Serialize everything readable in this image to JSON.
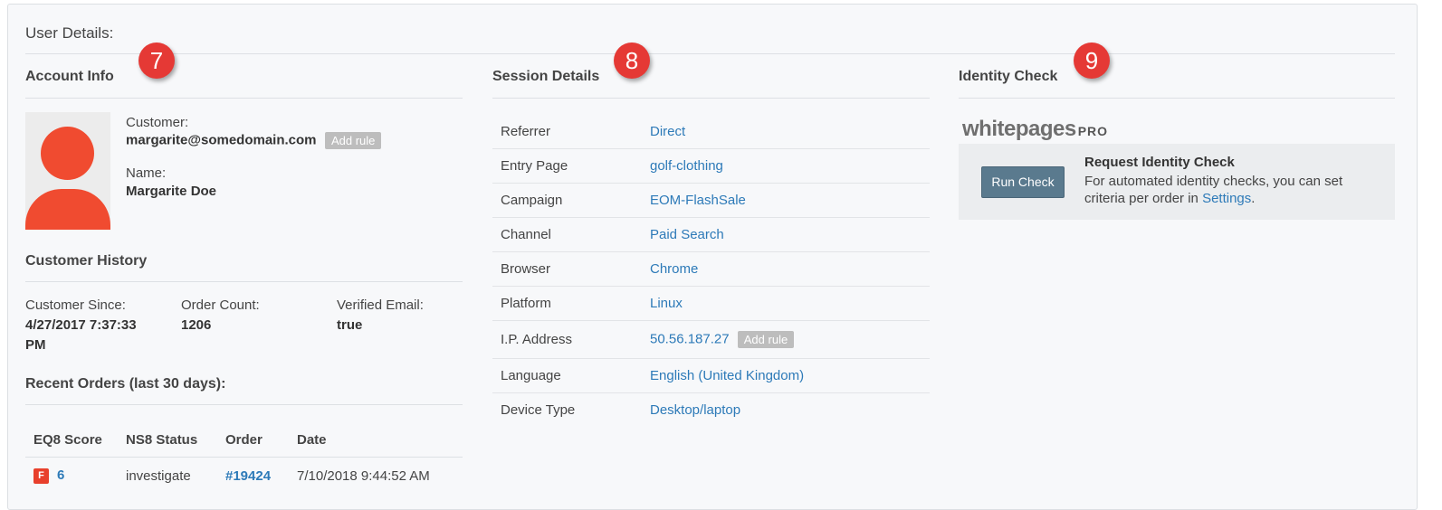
{
  "panel": {
    "title": "User Details:"
  },
  "account": {
    "heading": "Account Info",
    "badge": "7",
    "customer_label": "Customer:",
    "customer_email": "margarite@somedomain.com",
    "add_rule_label": "Add rule",
    "name_label": "Name:",
    "name_value": "Margarite Doe"
  },
  "history": {
    "heading": "Customer History",
    "since_label": "Customer Since:",
    "since_value": "4/27/2017 7:37:33 PM",
    "count_label": "Order Count:",
    "count_value": "1206",
    "verified_label": "Verified Email:",
    "verified_value": "true"
  },
  "orders": {
    "heading": "Recent Orders (last 30 days):",
    "columns": [
      "EQ8 Score",
      "NS8 Status",
      "Order",
      "Date"
    ],
    "rows": [
      {
        "flag": "F",
        "score": "6",
        "status": "investigate",
        "order": "#19424",
        "date": "7/10/2018 9:44:52 AM"
      }
    ]
  },
  "session": {
    "heading": "Session Details",
    "badge": "8",
    "add_rule_label": "Add rule",
    "rows": [
      {
        "key": "Referrer",
        "value": "Direct"
      },
      {
        "key": "Entry Page",
        "value": "golf-clothing"
      },
      {
        "key": "Campaign",
        "value": "EOM-FlashSale"
      },
      {
        "key": "Channel",
        "value": "Paid Search"
      },
      {
        "key": "Browser",
        "value": "Chrome"
      },
      {
        "key": "Platform",
        "value": "Linux"
      },
      {
        "key": "I.P. Address",
        "value": "50.56.187.27"
      },
      {
        "key": "Language",
        "value": "English (United Kingdom)"
      },
      {
        "key": "Device Type",
        "value": "Desktop/laptop"
      }
    ]
  },
  "identity": {
    "heading": "Identity Check",
    "badge": "9",
    "logo_text": "whitepages",
    "logo_pro": "PRO",
    "button_label": "Run Check",
    "title": "Request Identity Check",
    "desc_prefix": "For automated identity checks, you can set criteria per order in ",
    "desc_link": "Settings",
    "desc_suffix": "."
  },
  "colors": {
    "badge": "#e53935",
    "link": "#2d7ab8",
    "avatar": "#f04b30",
    "button": "#5a7a8e"
  }
}
